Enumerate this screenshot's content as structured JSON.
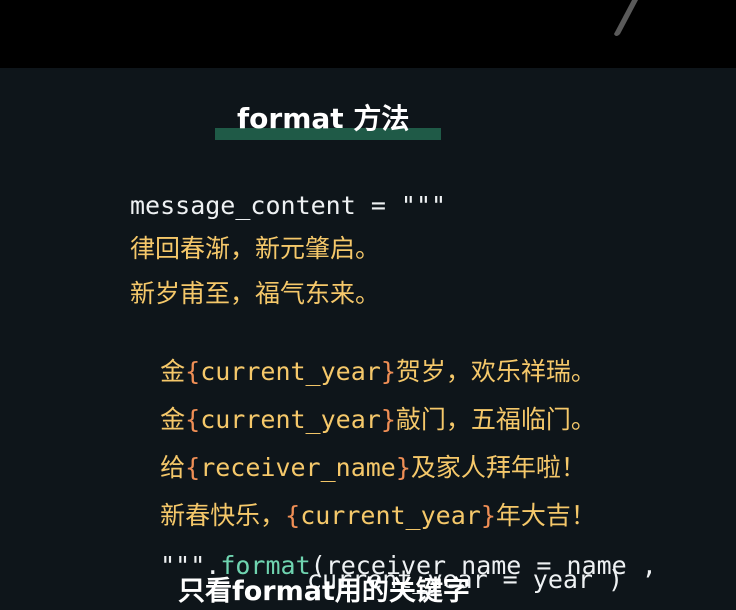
{
  "slide": {
    "title": "format 方法"
  },
  "code": {
    "line1": "message_content = \"\"\"",
    "line2": "律回春渐，新元肇启。",
    "line3": "新岁甫至，福气东来。",
    "line4": {
      "prefix": "金",
      "open": "{",
      "var": "current_year",
      "close": "}",
      "suffix": "贺岁，欢乐祥瑞。"
    },
    "line5": {
      "prefix": "金",
      "open": "{",
      "var": "current_year",
      "close": "}",
      "suffix": "敲门，五福临门。"
    },
    "line6": {
      "prefix": "给",
      "open": "{",
      "var": "receiver_name",
      "close": "}",
      "suffix": "及家人拜年啦！"
    },
    "line7": {
      "prefix": "新春快乐，",
      "open": "{",
      "var": "current_year",
      "close": "}",
      "suffix": "年大吉！"
    },
    "line8": {
      "quotes": "\"\"\"",
      "dot": ".",
      "method": "format",
      "args": "(receiver_name = name ,"
    },
    "line9": "current_year = year )"
  },
  "caption": {
    "text": "只看format用的关键字"
  },
  "colors": {
    "background": "#0e151a",
    "top_bar": "#000000",
    "title_highlight": "#1f5a47",
    "string_text": "#f5c86a",
    "brace": "#ef8e55",
    "method": "#6fd4b0",
    "plain": "#eef1f3"
  }
}
